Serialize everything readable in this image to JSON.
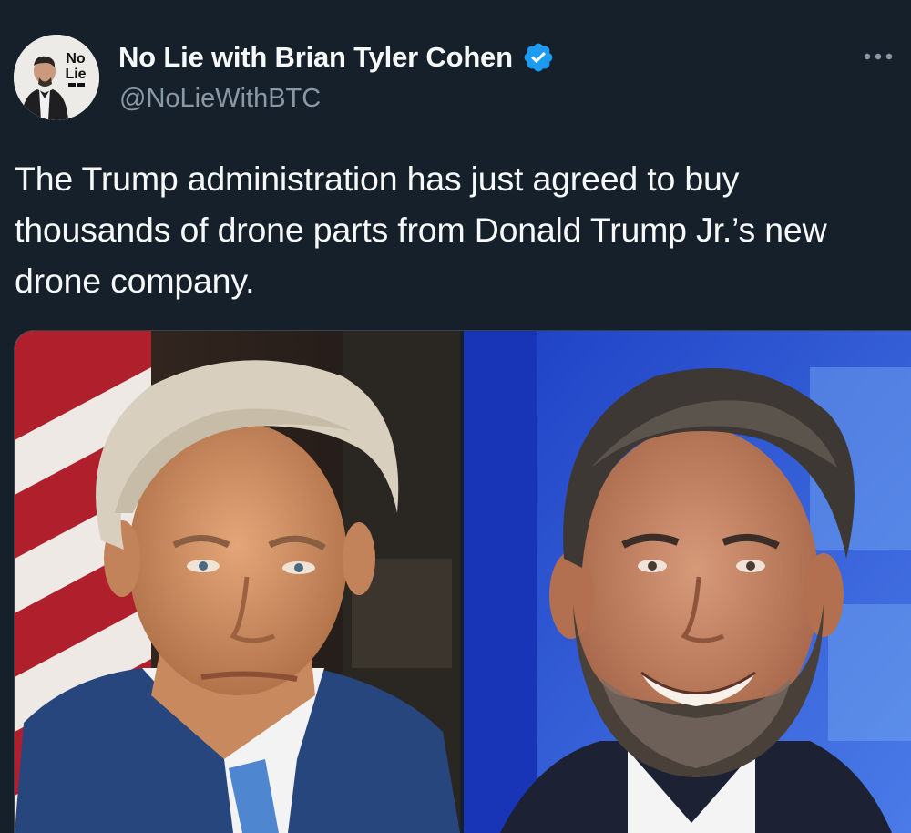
{
  "author": {
    "display_name": "No Lie with Brian Tyler Cohen",
    "handle": "@NoLieWithBTC",
    "avatar_text": [
      "No",
      "Lie"
    ],
    "verified": true,
    "verified_color": "#1d9bf0"
  },
  "tweet": {
    "text": "The Trump administration has just agreed to buy thousands of drone parts from Donald Trump Jr.’s new drone company."
  },
  "icons": {
    "more": "more-horizontal-icon",
    "verified": "verified-badge-icon"
  },
  "media": {
    "count": 2
  },
  "colors": {
    "background": "#15202b",
    "text_primary": "#f7f9f9",
    "text_secondary": "#8b98a5",
    "border": "#38444d"
  }
}
